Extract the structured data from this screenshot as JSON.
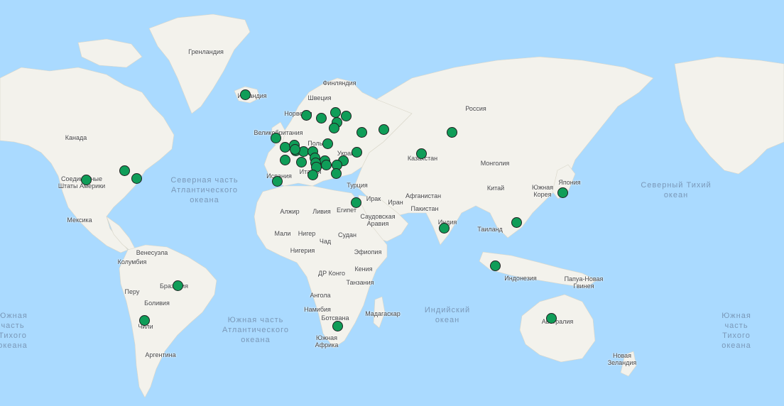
{
  "map": {
    "countries": [
      {
        "id": "greenland",
        "label": "Гренландия"
      },
      {
        "id": "iceland",
        "label": "Исландия"
      },
      {
        "id": "finland",
        "label": "Финляндия"
      },
      {
        "id": "sweden",
        "label": "Швеция"
      },
      {
        "id": "norway",
        "label": "Норвегия"
      },
      {
        "id": "russia",
        "label": "Россия"
      },
      {
        "id": "uk",
        "label": "Великобритания"
      },
      {
        "id": "poland",
        "label": "Польша"
      },
      {
        "id": "ukraine",
        "label": "Украина"
      },
      {
        "id": "kazakhstan",
        "label": "Казахстан"
      },
      {
        "id": "mongolia",
        "label": "Монголия"
      },
      {
        "id": "canada",
        "label": "Канада"
      },
      {
        "id": "usa",
        "label": "Соединённые Штаты Америки"
      },
      {
        "id": "spain",
        "label": "Испания"
      },
      {
        "id": "italy",
        "label": "Италия"
      },
      {
        "id": "turkey",
        "label": "Турция"
      },
      {
        "id": "iraq",
        "label": "Ирак"
      },
      {
        "id": "iran",
        "label": "Иран"
      },
      {
        "id": "afghanistan",
        "label": "Афганистан"
      },
      {
        "id": "pakistan",
        "label": "Пакистан"
      },
      {
        "id": "china",
        "label": "Китай"
      },
      {
        "id": "south-korea",
        "label": "Южная Корея"
      },
      {
        "id": "japan",
        "label": "Япония"
      },
      {
        "id": "algeria",
        "label": "Алжир"
      },
      {
        "id": "libya",
        "label": "Ливия"
      },
      {
        "id": "egypt",
        "label": "Египет"
      },
      {
        "id": "saudi-arabia",
        "label": "Саудовская Аравия"
      },
      {
        "id": "india",
        "label": "Индия"
      },
      {
        "id": "thailand",
        "label": "Таиланд"
      },
      {
        "id": "mexico",
        "label": "Мексика"
      },
      {
        "id": "mali",
        "label": "Мали"
      },
      {
        "id": "niger",
        "label": "Нигер"
      },
      {
        "id": "sudan",
        "label": "Судан"
      },
      {
        "id": "chad",
        "label": "Чад"
      },
      {
        "id": "nigeria",
        "label": "Нигерия"
      },
      {
        "id": "ethiopia",
        "label": "Эфиопия"
      },
      {
        "id": "venezuela",
        "label": "Венесуэла"
      },
      {
        "id": "colombia",
        "label": "Колумбия"
      },
      {
        "id": "dr-congo",
        "label": "ДР Конго"
      },
      {
        "id": "kenya",
        "label": "Кения"
      },
      {
        "id": "tanzania",
        "label": "Танзания"
      },
      {
        "id": "indonesia",
        "label": "Индонезия"
      },
      {
        "id": "papua",
        "label": "Папуа-Новая Гвинея"
      },
      {
        "id": "peru",
        "label": "Перу"
      },
      {
        "id": "brazil",
        "label": "Бразилия"
      },
      {
        "id": "bolivia",
        "label": "Боливия"
      },
      {
        "id": "angola",
        "label": "Ангола"
      },
      {
        "id": "namibia",
        "label": "Намибия"
      },
      {
        "id": "madagascar",
        "label": "Мадагаскар"
      },
      {
        "id": "botswana",
        "label": "Ботсвана"
      },
      {
        "id": "australia",
        "label": "Австралия"
      },
      {
        "id": "chile",
        "label": "Чили"
      },
      {
        "id": "south-africa",
        "label": "Южная Африка"
      },
      {
        "id": "argentina",
        "label": "Аргентина"
      },
      {
        "id": "new-zealand",
        "label": "Новая Зеландия"
      }
    ],
    "oceans": [
      {
        "id": "north-atlantic",
        "label": "Северная часть Атлантического океана"
      },
      {
        "id": "north-pacific",
        "label": "Северный Тихий океан"
      },
      {
        "id": "indian",
        "label": "Индийский океан"
      },
      {
        "id": "south-atlantic",
        "label": "Южная часть Атлантического океана"
      },
      {
        "id": "south-pacific-left",
        "label": "Южная часть Тихого океана"
      },
      {
        "id": "south-pacific-right",
        "label": "Южная часть Тихого океана"
      }
    ],
    "marker_color": "#0f9d58",
    "markers": [
      "iceland",
      "norway",
      "sweden-west",
      "finland",
      "estonia",
      "latvia",
      "lithuania",
      "russia-moscow",
      "russia-volga",
      "russia-siberia",
      "kazakhstan",
      "ukraine",
      "moldova",
      "belarus-south",
      "uk",
      "ireland",
      "netherlands",
      "belgium",
      "france",
      "switzerland",
      "germany",
      "czechia",
      "austria",
      "hungary",
      "slovenia",
      "croatia",
      "serbia",
      "romania",
      "bulgaria",
      "italy",
      "greece",
      "spain",
      "israel",
      "usa-central",
      "canada-east",
      "usa-east",
      "brazil",
      "chile",
      "south-africa",
      "india",
      "vietnam",
      "indonesia",
      "japan",
      "australia"
    ]
  }
}
